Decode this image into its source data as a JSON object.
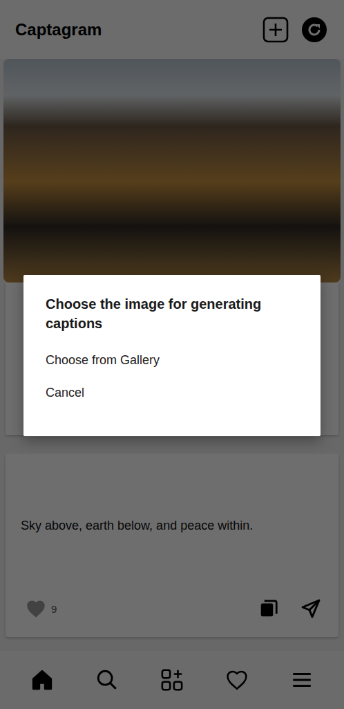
{
  "header": {
    "title": "Captagram"
  },
  "post": {
    "caption": "Sky above, earth below, and peace within.",
    "likes": "9",
    "liked": false
  },
  "dialog": {
    "title": "Choose the image for generating captions",
    "options": [
      {
        "label": "Choose from Gallery"
      },
      {
        "label": "Cancel"
      }
    ]
  },
  "nav": [
    {
      "kind": "home",
      "selected": true
    },
    {
      "kind": "search",
      "selected": false
    },
    {
      "kind": "add",
      "selected": false
    },
    {
      "kind": "likes",
      "selected": false
    },
    {
      "kind": "menu",
      "selected": false
    }
  ]
}
